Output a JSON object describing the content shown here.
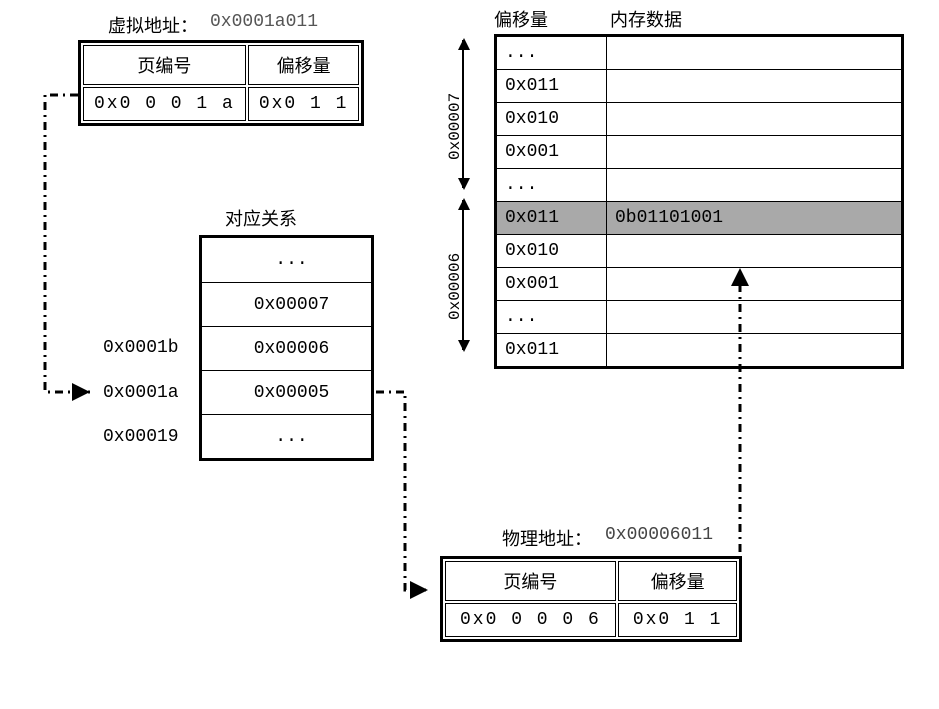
{
  "virtual_address": {
    "label": "虚拟地址：",
    "value": "0x0001a011",
    "col_page": "页编号",
    "col_offset": "偏移量",
    "page_no": "0x0  0  0  1  a",
    "offset": "0x0  1  1"
  },
  "page_table": {
    "label": "对应关系",
    "rows": [
      "...",
      "0x00007",
      "0x00006",
      "0x00005",
      "..."
    ],
    "index_labels": [
      "0x0001b",
      "0x0001a",
      "0x00019"
    ]
  },
  "memory": {
    "header_offset": "偏移量",
    "header_data": "内存数据",
    "bracket1_label": "0x00007",
    "bracket2_label": "0x00006",
    "rows": [
      {
        "off": "...",
        "data": ""
      },
      {
        "off": "0x011",
        "data": ""
      },
      {
        "off": "0x010",
        "data": ""
      },
      {
        "off": "0x001",
        "data": ""
      },
      {
        "off": "...",
        "data": ""
      },
      {
        "off": "0x011",
        "data": "0b01101001",
        "hl": true
      },
      {
        "off": "0x010",
        "data": ""
      },
      {
        "off": "0x001",
        "data": ""
      },
      {
        "off": "...",
        "data": ""
      },
      {
        "off": "0x011",
        "data": ""
      }
    ]
  },
  "physical_address": {
    "label": "物理地址：",
    "value": "0x00006011",
    "col_page": "页编号",
    "col_offset": "偏移量",
    "page_no": "0x0  0  0  0  6",
    "offset": "0x0  1  1"
  }
}
